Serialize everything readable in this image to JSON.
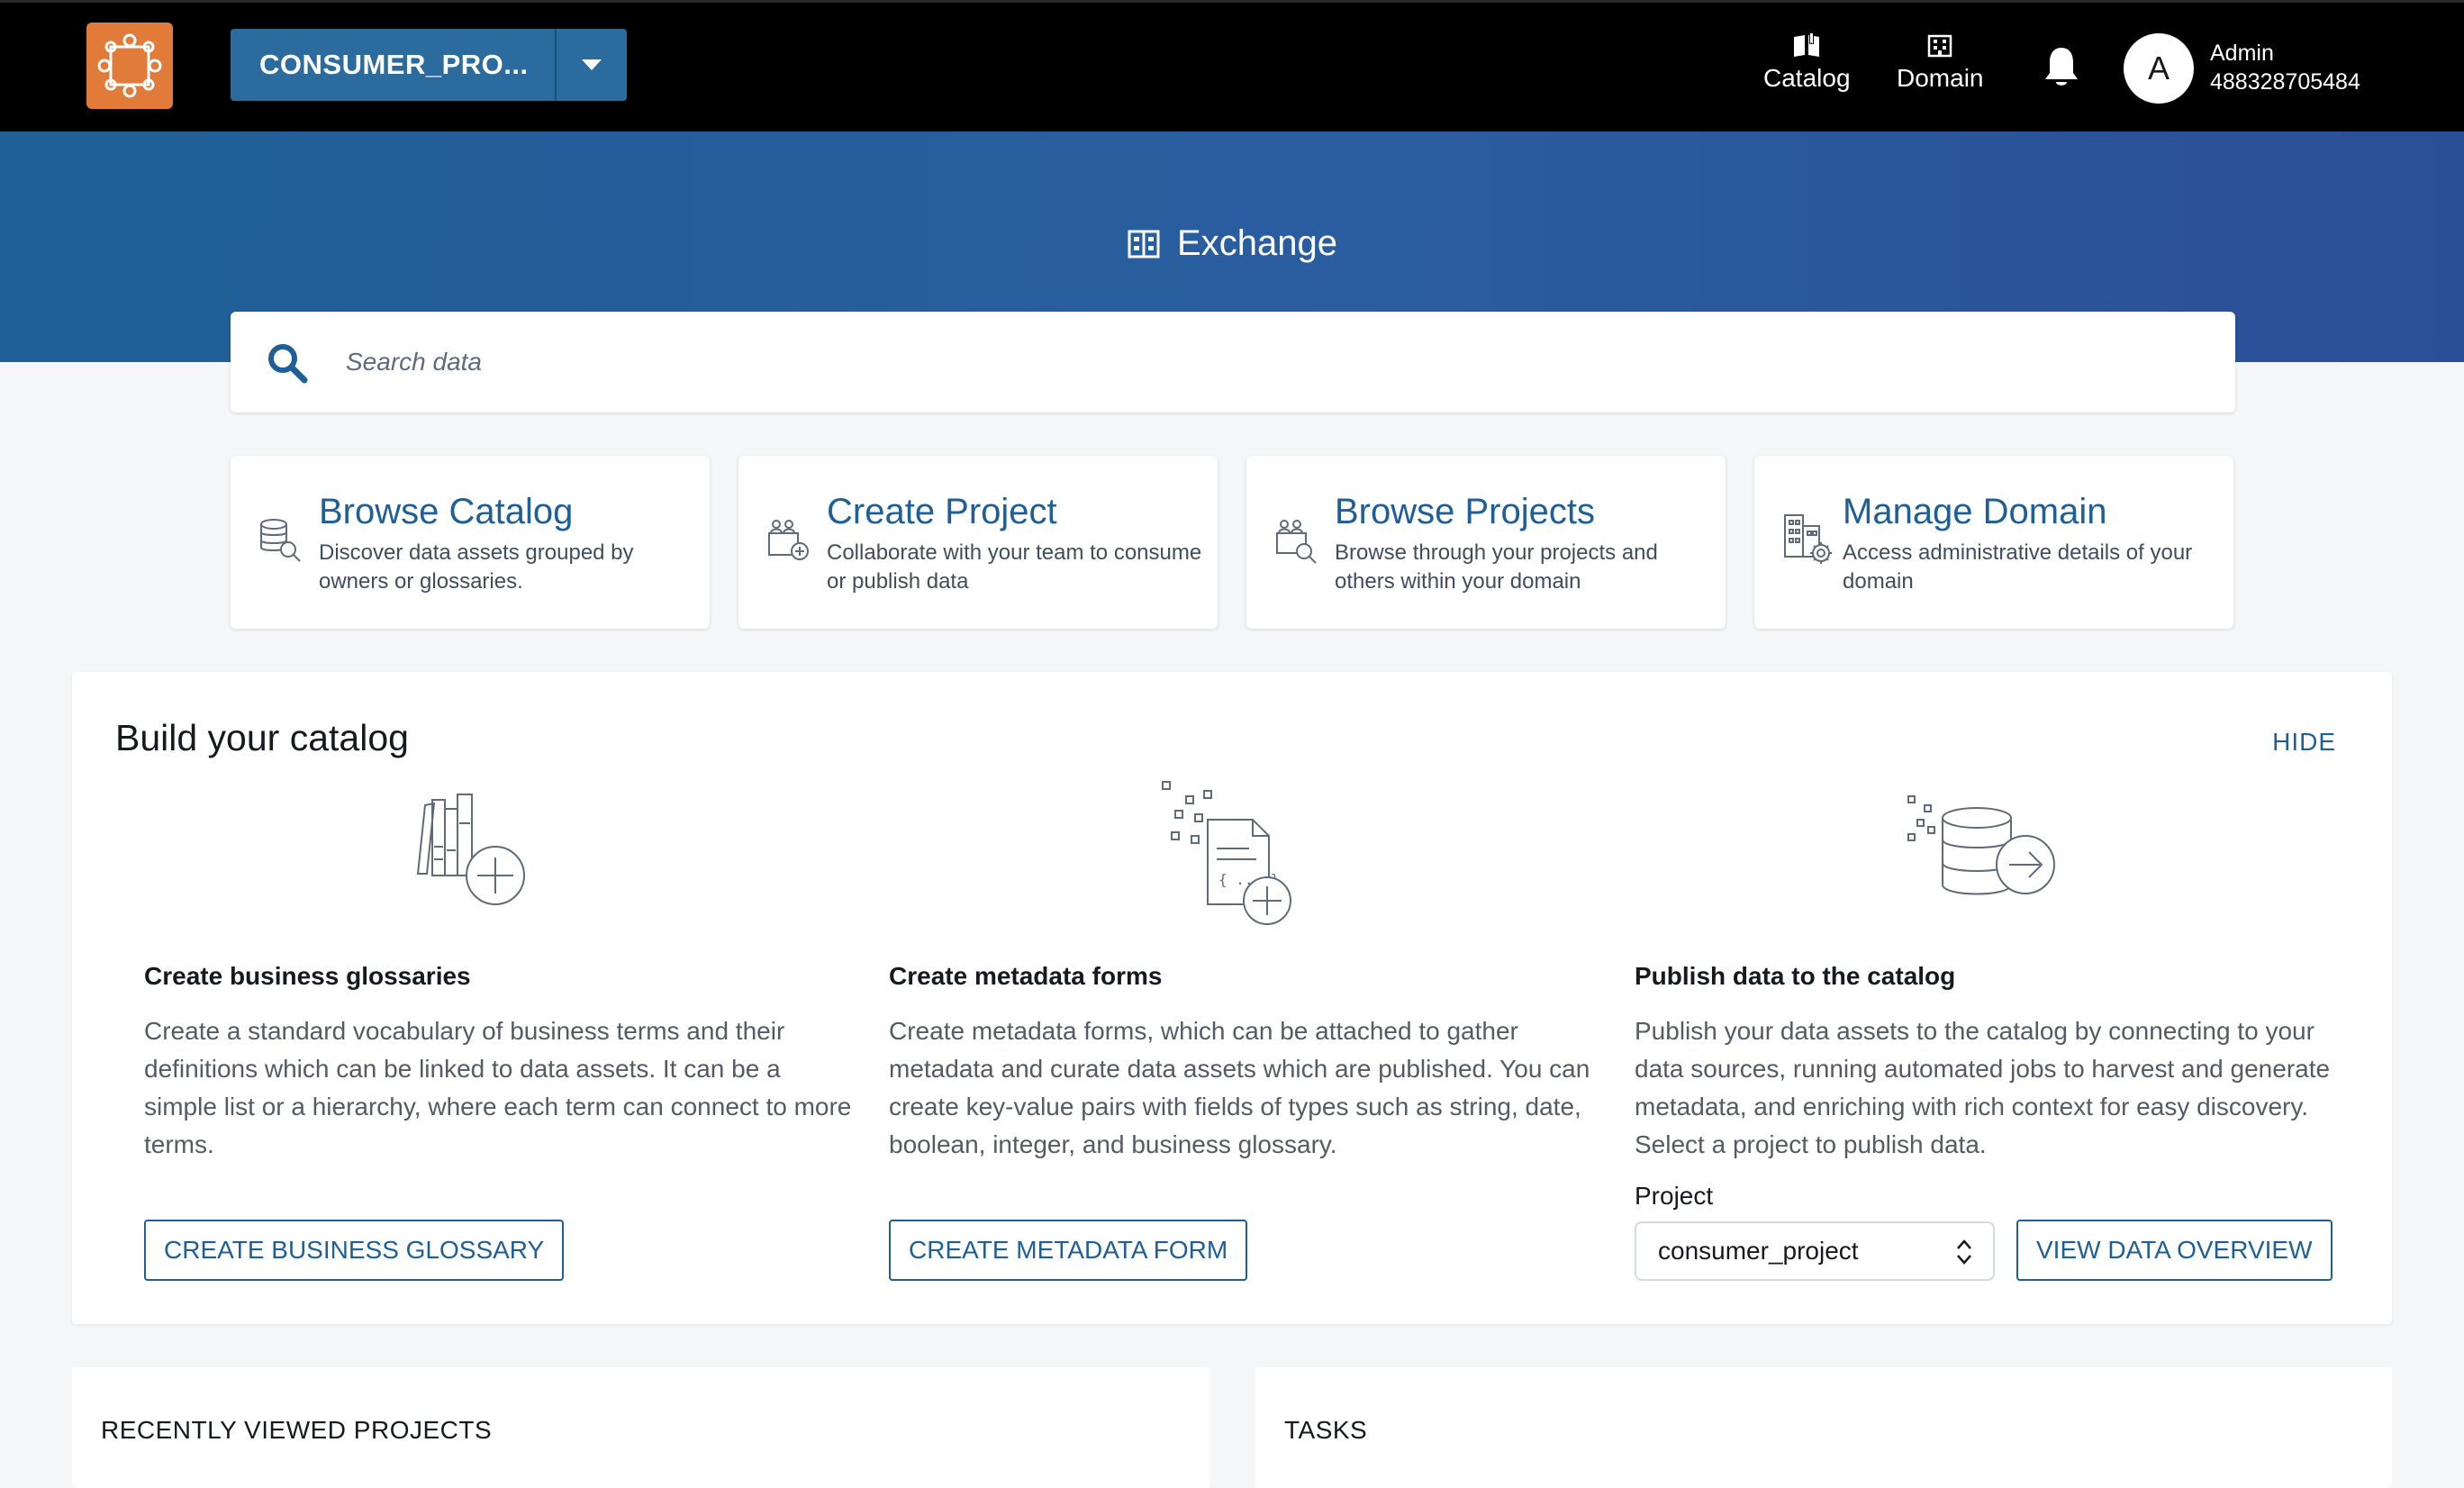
{
  "topbar": {
    "project_name": "CONSUMER_PRO...",
    "nav": [
      {
        "label": "Catalog",
        "icon": "catalog-icon"
      },
      {
        "label": "Domain",
        "icon": "domain-icon"
      }
    ],
    "avatar_initial": "A",
    "user_name": "Admin",
    "user_account": "488328705484"
  },
  "banner": {
    "title": "Exchange"
  },
  "search": {
    "placeholder": "Search data"
  },
  "cards": [
    {
      "title": "Browse Catalog",
      "desc": "Discover data assets grouped by owners or glossaries.",
      "icon": "browse-catalog-icon"
    },
    {
      "title": "Create Project",
      "desc": "Collaborate with your team to consume or publish data",
      "icon": "create-project-icon"
    },
    {
      "title": "Browse Projects",
      "desc": "Browse through your projects and others within your domain",
      "icon": "browse-projects-icon"
    },
    {
      "title": "Manage Domain",
      "desc": "Access administrative details of your domain",
      "icon": "manage-domain-icon"
    }
  ],
  "build": {
    "title": "Build your catalog",
    "hide_label": "HIDE",
    "columns": [
      {
        "heading": "Create business glossaries",
        "text": "Create a standard vocabulary of business terms and their definitions which can be linked to data assets. It can be a simple list or a hierarchy, where each term can connect to more terms.",
        "button": "CREATE BUSINESS GLOSSARY"
      },
      {
        "heading": "Create metadata forms",
        "text": "Create metadata forms, which can be attached to gather metadata and curate data assets which are published. You can create key-value pairs with fields of types such as string, date, boolean, integer, and business glossary.",
        "button": "CREATE METADATA FORM"
      },
      {
        "heading": "Publish data to the catalog",
        "text": "Publish your data assets to the catalog by connecting to your data sources, running automated jobs to harvest and generate metadata, and enriching with rich context for easy discovery. Select a project to publish data.",
        "project_label": "Project",
        "project_value": "consumer_project",
        "button": "VIEW DATA OVERVIEW"
      }
    ]
  },
  "bottom": {
    "recent_title": "RECENTLY VIEWED PROJECTS",
    "tasks_title": "TASKS"
  },
  "colors": {
    "accent": "#1f5f95",
    "logo": "#e07b39",
    "topbar": "#000000"
  }
}
